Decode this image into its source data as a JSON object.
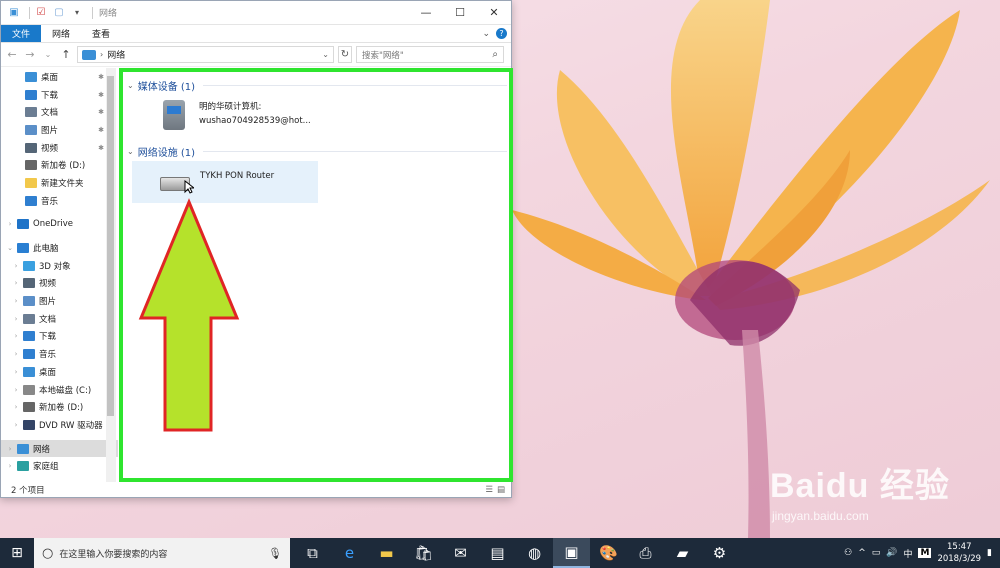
{
  "window": {
    "title": "网络",
    "tabs": [
      "文件",
      "网络",
      "查看"
    ],
    "address": "网络",
    "search_placeholder": "搜索\"网络\"",
    "status": "2 个项目"
  },
  "sidebar": {
    "items": [
      {
        "label": "桌面",
        "pinned": true,
        "color": "#3a8fd6"
      },
      {
        "label": "下载",
        "pinned": true,
        "color": "#2f7fd0"
      },
      {
        "label": "文档",
        "pinned": true,
        "color": "#6b7d93"
      },
      {
        "label": "图片",
        "pinned": true,
        "color": "#5b8fc8"
      },
      {
        "label": "视频",
        "pinned": true,
        "color": "#556677"
      },
      {
        "label": "新加卷 (D:)",
        "pinned": false,
        "color": "#666666"
      },
      {
        "label": "新建文件夹",
        "pinned": false,
        "color": "#f2c84b"
      },
      {
        "label": "音乐",
        "pinned": false,
        "color": "#2f7fd0"
      },
      {
        "label": "OneDrive",
        "pinned": false,
        "color": "#1e73c8",
        "expand": true
      },
      {
        "label": "此电脑",
        "pinned": false,
        "color": "#2a7fd2",
        "expand": true,
        "expanded": true
      },
      {
        "label": "3D 对象",
        "pinned": false,
        "color": "#3aa0e0",
        "expand": true,
        "indent": true
      },
      {
        "label": "视频",
        "pinned": false,
        "color": "#556677",
        "expand": true,
        "indent": true
      },
      {
        "label": "图片",
        "pinned": false,
        "color": "#5b8fc8",
        "expand": true,
        "indent": true
      },
      {
        "label": "文档",
        "pinned": false,
        "color": "#6b7d93",
        "expand": true,
        "indent": true
      },
      {
        "label": "下载",
        "pinned": false,
        "color": "#2f7fd0",
        "expand": true,
        "indent": true
      },
      {
        "label": "音乐",
        "pinned": false,
        "color": "#2f7fd0",
        "expand": true,
        "indent": true
      },
      {
        "label": "桌面",
        "pinned": false,
        "color": "#3a8fd6",
        "expand": true,
        "indent": true
      },
      {
        "label": "本地磁盘 (C:)",
        "pinned": false,
        "color": "#888888",
        "expand": true,
        "indent": true
      },
      {
        "label": "新加卷 (D:)",
        "pinned": false,
        "color": "#666666",
        "expand": true,
        "indent": true
      },
      {
        "label": "DVD RW 驱动器",
        "pinned": false,
        "color": "#334466",
        "expand": true,
        "indent": true
      },
      {
        "label": "网络",
        "pinned": false,
        "color": "#3a8fd6",
        "expand": true,
        "selected": true
      },
      {
        "label": "家庭组",
        "pinned": false,
        "color": "#2aa0a0",
        "expand": true
      }
    ]
  },
  "content": {
    "group1_header": "媒体设备 (1)",
    "device1_name": "明的华硕计算机:",
    "device1_sub": "wushao704928539@hot...",
    "group2_header": "网络设施 (1)",
    "device2_name": "TYKH PON Router"
  },
  "taskbar": {
    "search_placeholder": "在这里输入你要搜索的内容",
    "ime": "中",
    "time": "15:47",
    "date": "2018/3/29"
  },
  "watermark": {
    "main": "Baidu 经验",
    "sub": "jingyan.baidu.com"
  },
  "colors": {
    "highlight_border": "#2fe52f",
    "arrow_fill": "#b5e22b",
    "arrow_stroke": "#e02525",
    "accent": "#1979ca"
  }
}
